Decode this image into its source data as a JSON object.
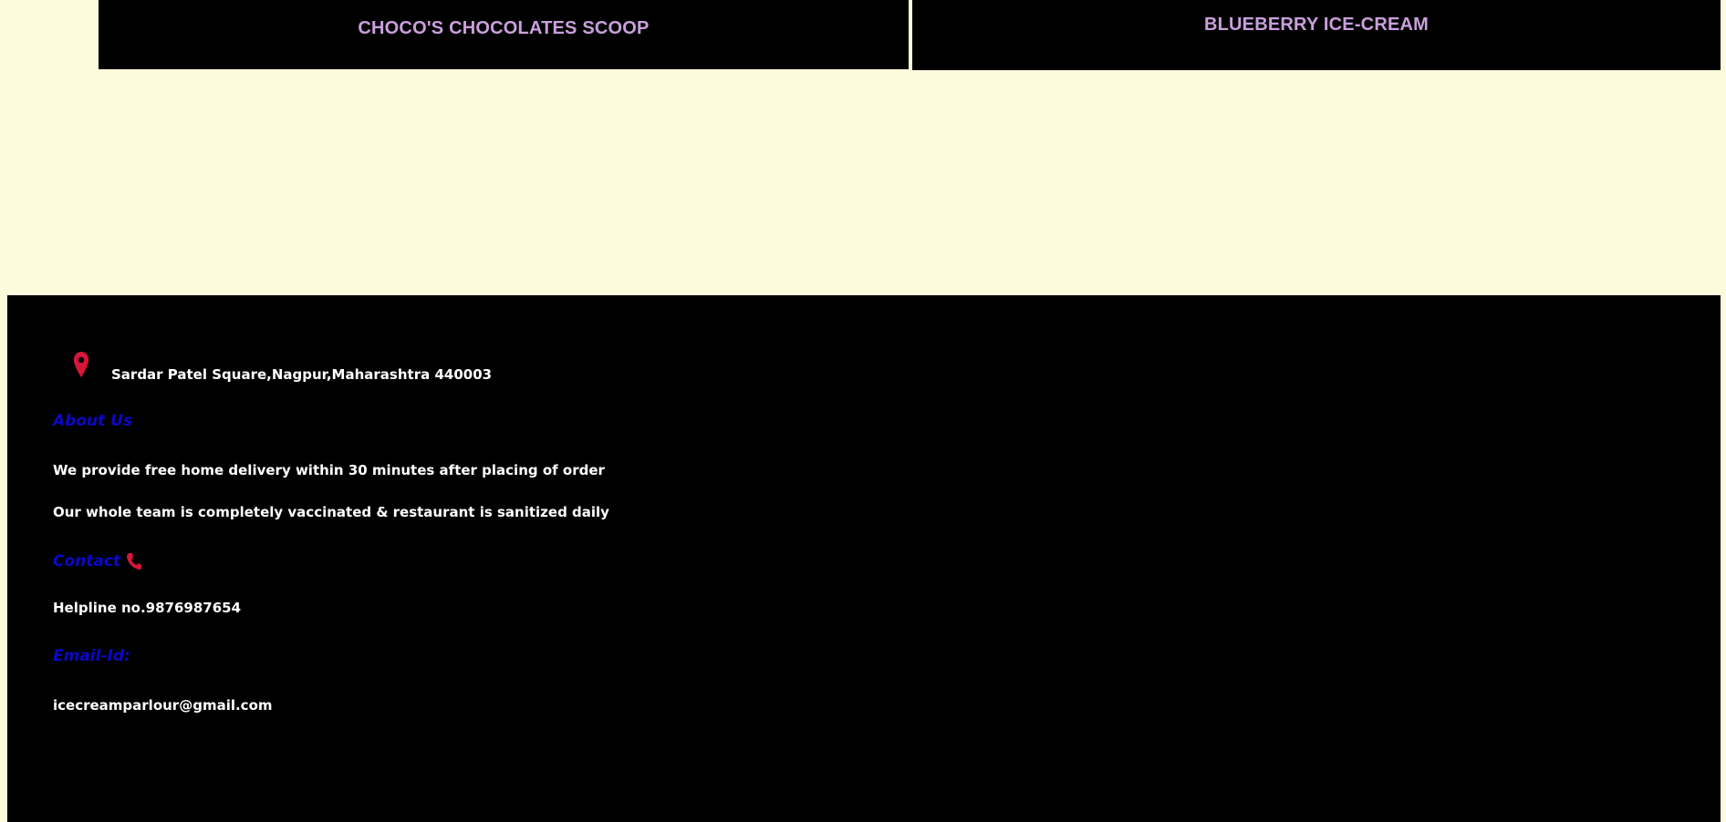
{
  "cards": [
    {
      "title": "CHOCO'S CHOCOLATES SCOOP"
    },
    {
      "title": "BLUEBERRY ICE-CREAM"
    }
  ],
  "footer": {
    "address": "Sardar Patel Square,Nagpur,Maharashtra 440003",
    "about_heading": "About Us",
    "about_lines": [
      "We provide free home delivery within 30 minutes after placing of order",
      "Our whole team is completely vaccinated & restaurant is sanitized daily"
    ],
    "contact_heading": "Contact",
    "helpline": "Helpline no.9876987654",
    "email_heading": "Email-Id:",
    "email": "icecreamparlour@gmail.com"
  },
  "colors": {
    "background": "#FEFADC",
    "card_bg": "#000000",
    "card_title": "#C9A0DC",
    "heading": "#0B07C8",
    "icon_red": "#D6153A"
  },
  "icons": {
    "location": "location-pin-icon",
    "phone": "phone-icon"
  }
}
